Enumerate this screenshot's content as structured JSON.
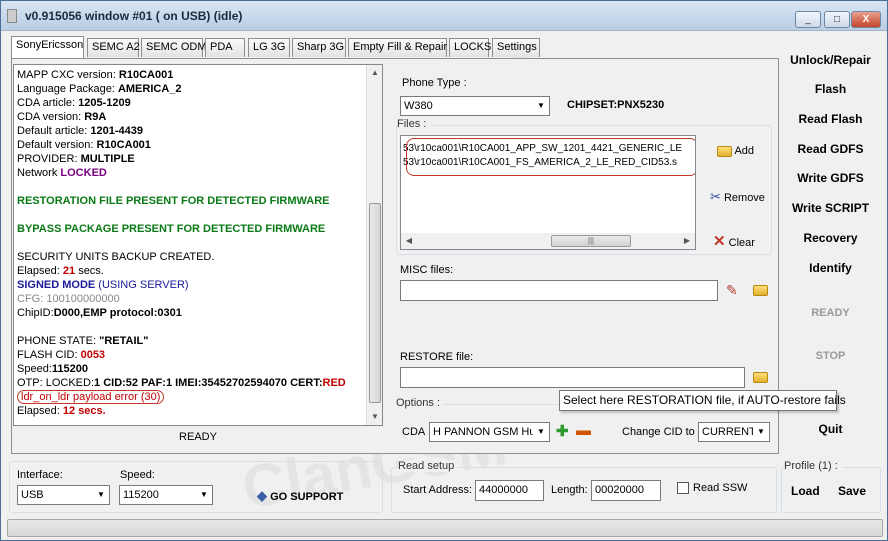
{
  "window": {
    "title": "v0.915056 window #01 ( on USB) (idle)",
    "controls": {
      "minimize": "_",
      "maximize": "□",
      "close": "X"
    }
  },
  "tabs": [
    "SonyEricsson",
    "SEMC A2",
    "SEMC ODM",
    "PDA",
    "LG 3G",
    "Sharp 3G",
    "Empty Fill & Repair",
    "LOCKS",
    "Settings"
  ],
  "log": {
    "mapp_label": "MAPP CXC version:",
    "mapp_value": "R10CA001",
    "lang_label": "Language Package:",
    "lang_value": "AMERICA_2",
    "cda_art_label": "CDA article:",
    "cda_art_value": "1205-1209",
    "cda_ver_label": "CDA version:",
    "cda_ver_value": "R9A",
    "def_art_label": "Default article:",
    "def_art_value": "1201-4439",
    "def_ver_label": "Default version:",
    "def_ver_value": "R10CA001",
    "provider_label": "PROVIDER:",
    "provider_value": "MULTIPLE",
    "network_label": "Network",
    "network_value": "LOCKED",
    "restoration": "RESTORATION FILE PRESENT FOR DETECTED FIRMWARE",
    "bypass": "BYPASS PACKAGE PRESENT FOR DETECTED FIRMWARE",
    "security": "SECURITY UNITS BACKUP CREATED.",
    "elapsed1_label": "Elapsed:",
    "elapsed1_value": "21",
    "elapsed1_unit": "secs.",
    "signed": "SIGNED MODE",
    "signed_suffix": "(USING SERVER)",
    "cfg": "CFG: 100100000000",
    "chip_label": "ChipID:",
    "chip_value": "D000,EMP protocol:0301",
    "phone_state_label": "PHONE STATE:",
    "phone_state_value": "\"RETAIL\"",
    "flash_cid_label": "FLASH CID:",
    "flash_cid_value": "0053",
    "speed_label": "Speed:",
    "speed_value": "115200",
    "otp_label": "OTP: LOCKED:",
    "otp_cid": "1 CID:52 PAF:1 IMEI:35452702594070 CERT:",
    "otp_cert": "RED",
    "error": "ldr_on_ldr payload error (30)",
    "elapsed2_label": "Elapsed:",
    "elapsed2_value": "12",
    "elapsed2_unit": "secs."
  },
  "status": "READY",
  "phone_type": {
    "label": "Phone Type :",
    "value": "W380",
    "chipset": "CHIPSET:PNX5230"
  },
  "files": {
    "label": "Files :",
    "items": [
      "53\\r10ca001\\R10CA001_APP_SW_1201_4421_GENERIC_LE",
      "53\\r10ca001\\R10CA001_FS_AMERICA_2_LE_RED_CID53.s"
    ],
    "add": "Add",
    "remove": "Remove",
    "clear": "Clear"
  },
  "misc": {
    "label": "MISC files:",
    "value": ""
  },
  "restore": {
    "label": "RESTORE file:",
    "value": ""
  },
  "tooltip": "Select here RESTORATION file, if AUTO-restore fails",
  "options": {
    "label": "Options :",
    "cda_label": "CDA",
    "cda_value": "H PANNON GSM Hun",
    "change_cid_label": "Change CID to",
    "change_cid_value": "CURRENT"
  },
  "side_buttons": [
    "Unlock/Repair",
    "Flash",
    "Read Flash",
    "Read GDFS",
    "Write GDFS",
    "Write SCRIPT",
    "Recovery",
    "Identify",
    "READY",
    "STOP",
    "Quit"
  ],
  "interface": {
    "label": "Interface:",
    "value": "USB"
  },
  "speed": {
    "label": "Speed:",
    "value": "115200"
  },
  "go_support": "GO SUPPORT",
  "read_setup": {
    "label": "Read setup",
    "start_label": "Start Address:",
    "start_value": "44000000",
    "length_label": "Length:",
    "length_value": "00020000",
    "read_ssw": "Read SSW"
  },
  "profile": {
    "label": "Profile (1) :",
    "load": "Load",
    "save": "Save"
  },
  "watermark": [
    "ClanGSM",
    "CLANGSM.COM"
  ]
}
